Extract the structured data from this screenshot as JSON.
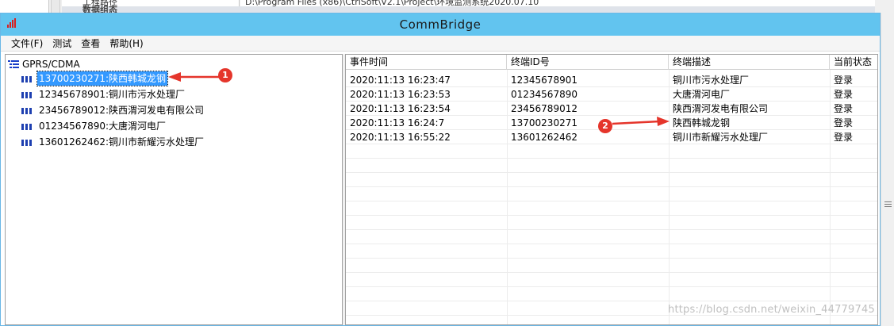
{
  "background": {
    "cell1": "工程路径",
    "cell2": "D:\\Program Files (x86)\\CtrlSoft\\V2.1\\Project\\环境监测系统2020.07.10",
    "row2": "数据组态"
  },
  "window": {
    "title": "CommBridge",
    "accent_color": "#62c4ef"
  },
  "menu": [
    "文件(F)",
    "测试",
    "查看",
    "帮助(H)"
  ],
  "tree": {
    "root": "GPRS/CDMA",
    "items": [
      {
        "label": "13700230271:陕西韩城龙钢",
        "selected": true
      },
      {
        "label": "12345678901:铜川市污水处理厂",
        "selected": false
      },
      {
        "label": "23456789012:陕西渭河发电有限公司",
        "selected": false
      },
      {
        "label": "01234567890:大唐渭河电厂",
        "selected": false
      },
      {
        "label": "13601262462:铜川市新耀污水处理厂",
        "selected": false
      }
    ]
  },
  "grid": {
    "columns": [
      "事件时间",
      "终端ID号",
      "终端描述",
      "当前状态"
    ],
    "rows": [
      [
        "2020:11:13 16:23:47",
        "12345678901",
        "铜川市污水处理厂",
        "登录"
      ],
      [
        "2020:11:13 16:23:53",
        "01234567890",
        "大唐渭河电厂",
        "登录"
      ],
      [
        "2020:11:13 16:23:54",
        "23456789012",
        "陕西渭河发电有限公司",
        "登录"
      ],
      [
        "2020:11:13 16:24:7",
        "13700230271",
        "陕西韩城龙钢",
        "登录"
      ],
      [
        "2020:11:13 16:55:22",
        "13601262462",
        "铜川市新耀污水处理厂",
        "登录"
      ]
    ]
  },
  "annotations": {
    "badge1": "1",
    "badge2": "2",
    "arrow_color": "#e5352b"
  },
  "watermark": "https://blog.csdn.net/weixin_44779745"
}
